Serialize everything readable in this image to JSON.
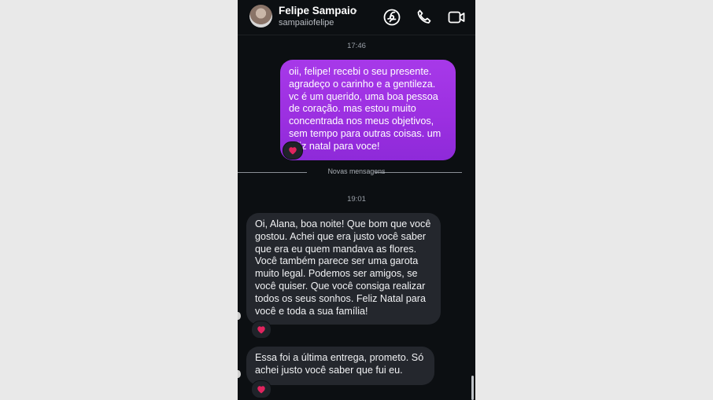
{
  "header": {
    "name": "Felipe Sampaio",
    "chevron": "›",
    "handle": "sampaiiofelipe",
    "icons": [
      "sticker-icon",
      "phone-call-icon",
      "video-call-icon"
    ]
  },
  "timestamps": {
    "first": "17:46",
    "second": "19:01"
  },
  "messages": {
    "sent": "oii, felipe! recebi o seu presente. agradeço o carinho e a gentileza. vc é um querido, uma boa pessoa de coração. mas estou muito concentrada nos meus objetivos, sem tempo para outras coisas. um feliz natal para voce!",
    "received_1": "Oi, Alana, boa noite! Que bom que você gostou. Achei que era justo você saber que era eu quem mandava as flores. Você também parece ser uma garota muito legal. Podemos ser amigos, se você quiser. Que você consiga realizar todos os seus sonhos. Feliz Natal para você e toda a sua família!",
    "received_2": "Essa foi a última entrega, prometo. Só achei justo você saber que fui eu."
  },
  "divider": {
    "label": "Novas mensagens"
  },
  "reactions": {
    "emoji": "heart",
    "color": "#e0245e"
  },
  "colors": {
    "sent_bubble": "#9b2fe0",
    "received_bubble": "#24272d",
    "background": "#0c0f12"
  }
}
